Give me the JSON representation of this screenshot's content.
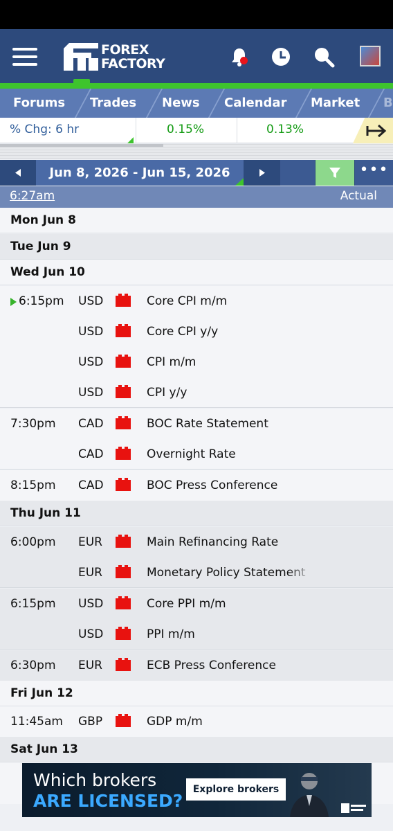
{
  "app": {
    "brand_line1": "FOREX",
    "brand_line2": "FACTORY"
  },
  "nav": {
    "items": [
      "Forums",
      "Trades",
      "News",
      "Calendar",
      "Market",
      "B"
    ]
  },
  "ticker": {
    "label": "% Chg: 6 hr",
    "values": [
      "0.15%",
      "0.13%"
    ]
  },
  "calendar": {
    "date_range": "Jun 8, 2026 - Jun 15, 2026",
    "current_time": "6:27am",
    "column_actual": "Actual",
    "days": [
      {
        "label": "Mon Jun 8",
        "events": []
      },
      {
        "label": "Tue Jun 9",
        "events": []
      },
      {
        "label": "Wed Jun 10",
        "events": [
          {
            "time": "6:15pm",
            "currency": "USD",
            "impact": "high",
            "title": "Core CPI m/m"
          },
          {
            "time": "",
            "currency": "USD",
            "impact": "high",
            "title": "Core CPI y/y"
          },
          {
            "time": "",
            "currency": "USD",
            "impact": "high",
            "title": "CPI m/m"
          },
          {
            "time": "",
            "currency": "USD",
            "impact": "high",
            "title": "CPI y/y"
          },
          {
            "time": "7:30pm",
            "currency": "CAD",
            "impact": "high",
            "title": "BOC Rate Statement"
          },
          {
            "time": "",
            "currency": "CAD",
            "impact": "high",
            "title": "Overnight Rate"
          },
          {
            "time": "8:15pm",
            "currency": "CAD",
            "impact": "high",
            "title": "BOC Press Conference"
          }
        ]
      },
      {
        "label": "Thu Jun 11",
        "events": [
          {
            "time": "6:00pm",
            "currency": "EUR",
            "impact": "high",
            "title": "Main Refinancing Rate"
          },
          {
            "time": "",
            "currency": "EUR",
            "impact": "high",
            "title": "Monetary Policy Statement"
          },
          {
            "time": "6:15pm",
            "currency": "USD",
            "impact": "high",
            "title": "Core PPI m/m"
          },
          {
            "time": "",
            "currency": "USD",
            "impact": "high",
            "title": "PPI m/m"
          },
          {
            "time": "6:30pm",
            "currency": "EUR",
            "impact": "high",
            "title": "ECB Press Conference"
          }
        ]
      },
      {
        "label": "Fri Jun 12",
        "events": [
          {
            "time": "11:45am",
            "currency": "GBP",
            "impact": "high",
            "title": "GDP m/m"
          }
        ]
      },
      {
        "label": "Sat Jun 13",
        "events": []
      }
    ]
  },
  "ad": {
    "line1": "Which brokers",
    "line2": "ARE LICENSED?",
    "button": "Explore brokers"
  },
  "colors": {
    "header": "#2d4a7c",
    "nav": "#5c7ab4",
    "accent_green": "#3ec42d",
    "impact_high": "#e8120f",
    "positive": "#129a12"
  }
}
